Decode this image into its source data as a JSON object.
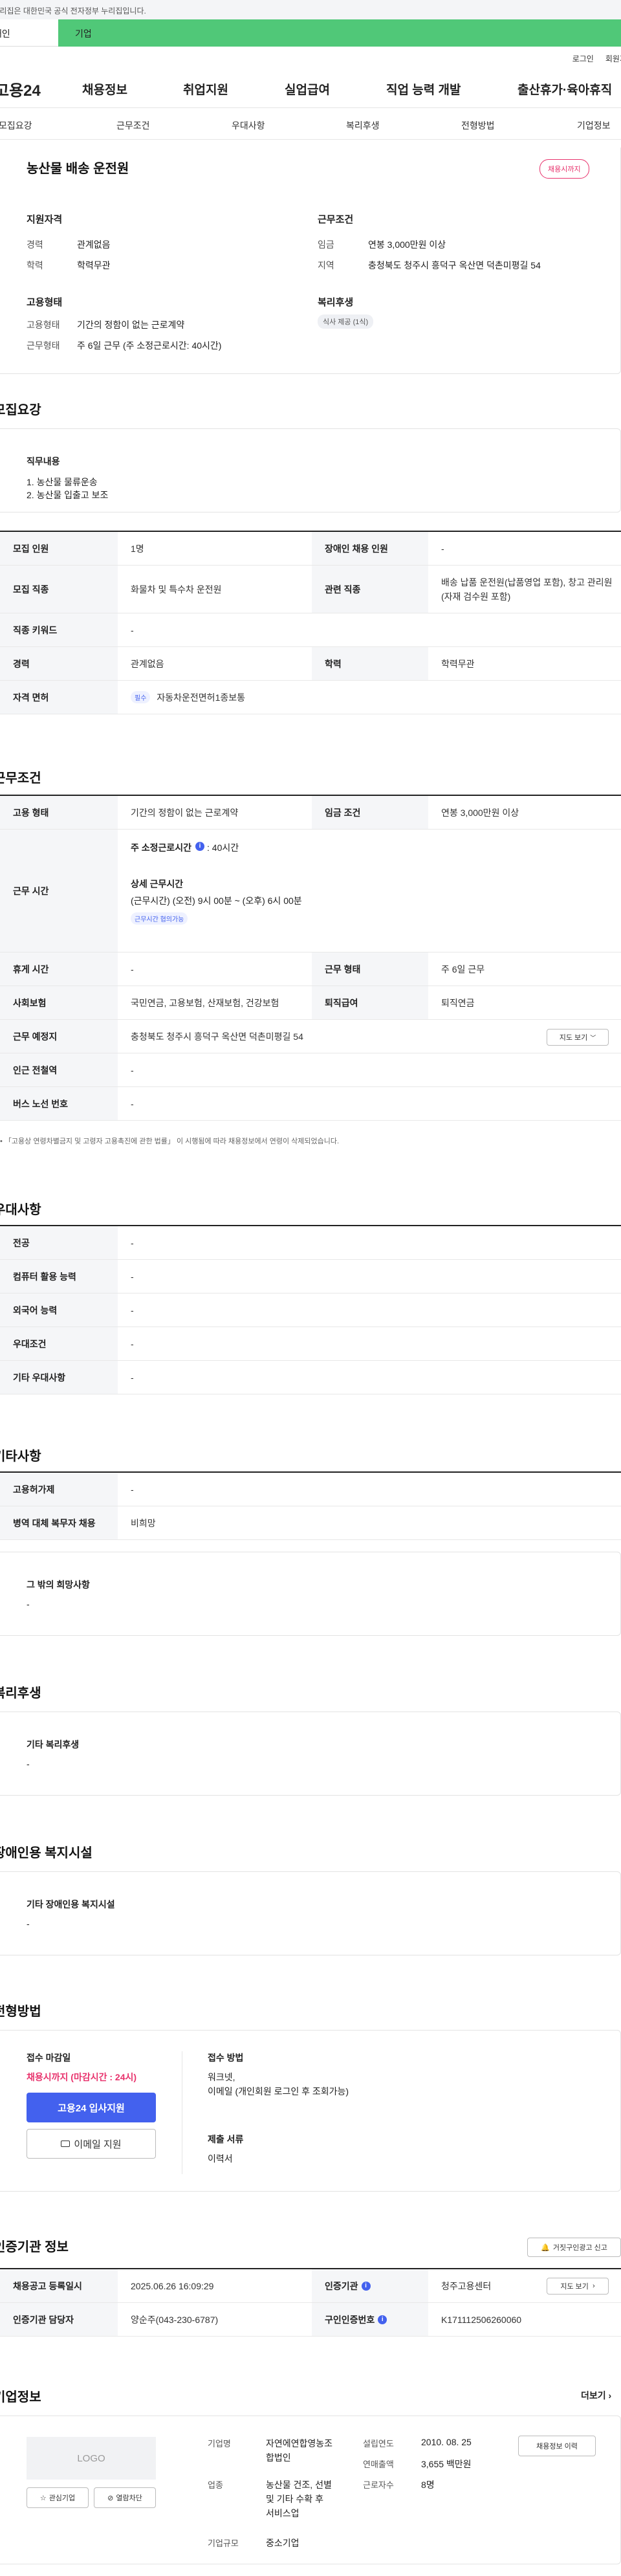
{
  "gov": {
    "text": "이 누리집은 대한민국 공식 전자정부 누리집입니다."
  },
  "seg": {
    "personal": "개인",
    "company": "기업"
  },
  "util": {
    "login": "로그인",
    "signup": "회원가입"
  },
  "gnb": {
    "logo": "고용24",
    "menu": [
      "채용정보",
      "취업지원",
      "실업급여",
      "직업 능력 개발",
      "출산휴가·육아휴직"
    ]
  },
  "subnav": [
    "모집요강",
    "근무조건",
    "우대사항",
    "복리후생",
    "전형방법",
    "기업정보"
  ],
  "summary": {
    "title": "농산물 배송 운전원",
    "badge": "채용시까지",
    "qual_title": "지원자격",
    "career_l": "경력",
    "career_v": "관계없음",
    "edu_l": "학력",
    "edu_v": "학력무관",
    "cond_title": "근무조건",
    "wage_l": "임금",
    "wage_v": "연봉 3,000만원 이상",
    "region_l": "지역",
    "region_v": "충청북도 청주시 흥덕구 옥산면 덕촌미평길 54",
    "emp_title": "고용형태",
    "emptype_l": "고용형태",
    "emptype_v": "기간의 정함이 없는 근로계약",
    "worktype_l": "근무형태",
    "worktype_v": "주 6일 근무 (주 소정근로시간: 40시간)",
    "welfare_title": "복리후생",
    "welfare_chip": "식사 제공 (1식)"
  },
  "recruit": {
    "heading": "모집요강",
    "duty_title": "직무내용",
    "duty_lines": [
      "1. 농산물 물류운송",
      "2. 농산물 입출고 보조"
    ],
    "rows": [
      {
        "l1": "모집 인원",
        "v1": "1명",
        "l2": "장애인 채용 인원",
        "v2": "-"
      },
      {
        "l1": "모집 직종",
        "v1": "화물차 및 특수차 운전원",
        "l2": "관련 직종",
        "v2": "배송 납품 운전원(납품영업 포함), 창고 관리원(자재 검수원 포함)"
      },
      {
        "l1": "직종 키워드",
        "v1": "-"
      },
      {
        "l1": "경력",
        "v1": "관계없음",
        "l2": "학력",
        "v2": "학력무관"
      },
      {
        "l1": "자격 면허",
        "chip": "필수",
        "v1": "자동차운전면허1종보통"
      }
    ]
  },
  "cond": {
    "heading": "근무조건",
    "emptype_l": "고용 형태",
    "emptype_v": "기간의 정함이 없는 근로계약",
    "wage_l": "임금 조건",
    "wage_v": "연봉 3,000만원 이상",
    "hours_l": "근무 시간",
    "hours_main": "주 소정근로시간",
    "hours_info": "i",
    "hours_main_v": ": 40시간",
    "hours_detail_t": "상세 근무시간",
    "hours_detail_v": "(근무시간) (오전) 9시 00분 ~ (오후) 6시 00분",
    "hours_chip": "근무시간 협의가능",
    "holiday_l": "휴게 시간",
    "holiday_v": "-",
    "worktype_l": "근무 형태",
    "worktype_v": "주 6일 근무",
    "insure_l": "사회보험",
    "insure_v": "국민연금, 고용보험, 산재보험, 건강보험",
    "retire_l": "퇴직급여",
    "retire_v": "퇴직연금",
    "place_l": "근무 예정지",
    "place_v": "충청북도 청주시 흥덕구 옥산면 덕촌미평길 54",
    "map_btn": "지도 보기",
    "subway_l": "인근 전철역",
    "subway_v": "-",
    "bus_l": "버스 노선 번호",
    "bus_v": "-",
    "note": "「고용상 연령차별금지 및 고령자 고용촉진에 관한 법률」 이 시행됨에 따라 채용정보에서 연령이 삭제되었습니다."
  },
  "prefer": {
    "heading": "우대사항",
    "rows": [
      {
        "l": "전공",
        "v": "-"
      },
      {
        "l": "컴퓨터 활용 능력",
        "v": "-"
      },
      {
        "l": "외국어 능력",
        "v": "-"
      },
      {
        "l": "우대조건",
        "v": "-"
      },
      {
        "l": "기타 우대사항",
        "v": "-"
      }
    ]
  },
  "etc": {
    "heading": "기타사항",
    "rows": [
      {
        "l": "고용허가제",
        "v": "-"
      },
      {
        "l": "병역 대체 복무자 채용",
        "v": "비희망"
      }
    ],
    "box_title": "그 밖의 희망사항",
    "box_v": "-"
  },
  "welfare": {
    "heading": "복리후생",
    "box_title": "기타 복리후생",
    "box_v": "-"
  },
  "disabled": {
    "heading": "장애인용 복지시설",
    "box_title": "기타 장애인용 복지시설",
    "box_v": "-"
  },
  "apply": {
    "heading": "전형방법",
    "deadline_t": "접수 마감일",
    "deadline_v": "채용시까지 (마감시간 : 24시)",
    "apply_btn": "고용24 입사지원",
    "email_btn": "이메일 지원",
    "method_t": "접수 방법",
    "method_v1": "워크넷,",
    "method_v2": "이메일 (개인회원 로그인 후 조회가능)",
    "docs_t": "제출 서류",
    "docs_v": "이력서"
  },
  "agency": {
    "heading": "인증기관 정보",
    "report_btn": "거짓구인광고 신고",
    "reg_l": "채용공고 등록일시",
    "reg_v": "2025.06.26 16:09:29",
    "org_l": "인증기관",
    "org_v": "청주고용센터",
    "map_btn": "지도 보기",
    "mgr_l": "인증기관 담당자",
    "mgr_v": "양순주(043-230-6787)",
    "num_l": "구인인증번호",
    "num_v": "K171112506260060"
  },
  "company": {
    "heading": "기업정보",
    "more": "더보기",
    "logo": "LOGO",
    "fav_btn": "관심기업",
    "block_btn": "열람차단",
    "name_l": "기업명",
    "name_v1": "자연에연합영농조",
    "name_v2": "합법인",
    "ind_l": "업종",
    "ind_v1": "농산물 건조, 선별",
    "ind_v2": "및 기타 수확 후",
    "ind_v3": "서비스업",
    "size_l": "기업규모",
    "size_v": "중소기업",
    "est_l": "설립연도",
    "est_v": "2010. 08. 25",
    "sales_l": "연매출액",
    "sales_v": "3,655 백만원",
    "emp_l": "근로자수",
    "emp_v": "8명",
    "history_btn": "채용정보 이력"
  },
  "colors": {
    "accent": "#e8336d",
    "brand": "#4361ee",
    "green": "#50c878"
  }
}
